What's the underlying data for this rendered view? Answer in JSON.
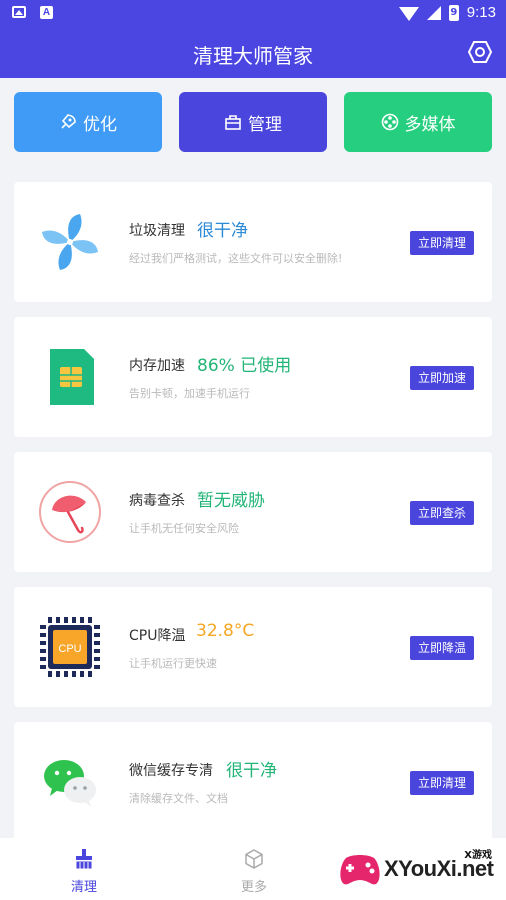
{
  "status_bar": {
    "time": "9:13",
    "battery": "9",
    "notif_a": "A"
  },
  "header": {
    "title": "清理大师管家"
  },
  "quick_tabs": [
    {
      "label": "优化",
      "color": "#3f9bf6"
    },
    {
      "label": "管理",
      "color": "#4a45dc"
    },
    {
      "label": "多媒体",
      "color": "#26cf7f"
    }
  ],
  "cards": [
    {
      "name": "垃圾清理",
      "status": "很干净",
      "status_color": "#2a8ad8",
      "desc": "经过我们严格测试，这些文件可以安全删除!",
      "action": "立即清理",
      "icon": "pinwheel-icon"
    },
    {
      "name": "内存加速",
      "status": "86% 已使用",
      "status_color": "#22b577",
      "desc": "告别卡顿，加速手机运行",
      "action": "立即加速",
      "icon": "sim-chip-icon"
    },
    {
      "name": "病毒查杀",
      "status": "暂无威胁",
      "status_color": "#22b577",
      "desc": "让手机无任何安全风险",
      "action": "立即查杀",
      "icon": "umbrella-icon"
    },
    {
      "name": "CPU降温",
      "status": "32.8°C",
      "status_color": "#f5a623",
      "desc": "让手机运行更快速",
      "action": "立即降温",
      "icon": "cpu-icon",
      "icon_text": "CPU"
    },
    {
      "name": "微信缓存专清",
      "status": "很干净",
      "status_color": "#22b577",
      "desc": "清除缓存文件、文档",
      "action": "立即清理",
      "icon": "wechat-icon"
    }
  ],
  "bottom_nav": [
    {
      "label": "清理",
      "active": true
    },
    {
      "label": "更多",
      "active": false
    }
  ],
  "watermark": {
    "text": "XYouXi.net",
    "small": "X游戏"
  },
  "colors": {
    "primary": "#4b46e2",
    "background": "#f2f3f7"
  }
}
